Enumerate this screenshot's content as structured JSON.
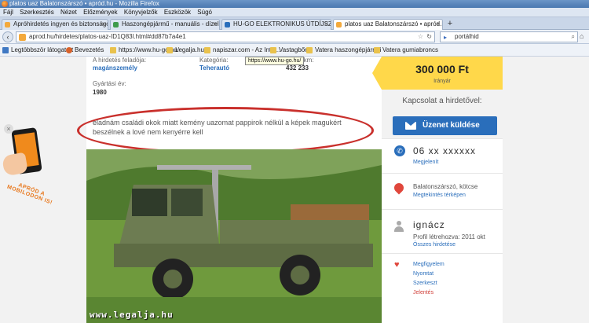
{
  "window": {
    "title": "platos uaz Balatonszárszó • apród.hu - Mozilla Firefox"
  },
  "menu": [
    "Fájl",
    "Szerkesztés",
    "Nézet",
    "Előzmények",
    "Könyvjelzők",
    "Eszközök",
    "Súgó"
  ],
  "tabs": [
    {
      "label": "Apróhirdetés ingyen és biztonságosa...",
      "icon_color": "#f3a93c"
    },
    {
      "label": "Haszongépjármű - manuális - dízel | ...",
      "icon_color": "#3f9b4c"
    },
    {
      "label": "HU-GO ELEKTRONIKUS ÚTDÍJSZEDÉSI ...",
      "icon_color": "#2a6ebb"
    },
    {
      "label": "platos uaz Balatonszárszó • apród.hu",
      "icon_color": "#f3a93c",
      "active": true
    }
  ],
  "nav": {
    "url": "aprod.hu/hirdetes/platos-uaz-ID1Q83l.html#dd87b7a4e1",
    "search_placeholder": "portálhid"
  },
  "bookmarks": [
    {
      "label": "Legtöbbször látogatott",
      "type": "blue"
    },
    {
      "label": "Bevezetés",
      "type": "dot"
    },
    {
      "label": "https://www.hu-go.hu/",
      "type": "folder"
    },
    {
      "label": "Legalja.hu",
      "type": "folder"
    },
    {
      "label": "napiszar.com - Az Inte...",
      "type": "folder"
    },
    {
      "label": "Vastagbőr",
      "type": "folder"
    },
    {
      "label": "Vatera haszongépjármű",
      "type": "folder"
    },
    {
      "label": "Vatera gumiabroncs",
      "type": "folder"
    }
  ],
  "tooltip": "https://www.hu-go.hu/",
  "listing": {
    "advertiser_label": "A hirdetés feladója:",
    "advertiser_value": "magánszemély",
    "condition_label": "Kategória:",
    "condition_value": "Teherautó",
    "mileage_label": "Futott km:",
    "mileage_value": "432 233",
    "year_label": "Gyártási év:",
    "year_value": "1980",
    "description": "eladnám családi okok miatt kemény uazomat pappirok nélkül a képek magukért beszélnek a lové nem kenyérre kell"
  },
  "watermark": "www.legalja.hu",
  "promo": {
    "text": "APRÓD A MOBILODON IS!"
  },
  "sidebar": {
    "price": "300 000 Ft",
    "price_sub": "Irányár",
    "contact_title": "Kapcsolat a hirdetővel:",
    "message_button": "Üzenet küldése",
    "phone": "06 xx xxxxxx",
    "phone_link": "Megjelenít",
    "location": "Balatonszárszó, kötcse",
    "map_link": "Megtekintés térképen",
    "user_name": "ignácz",
    "profile_created": "Profil létrehozva: 2011 okt",
    "all_ads_link": "Összes hirdetése",
    "actions": {
      "follow": "Megfigyelem",
      "print": "Nyomtat",
      "edit": "Szerkeszt",
      "report": "Jelentés"
    }
  },
  "colors": {
    "brand_blue": "#2a6ebb",
    "price_yellow": "#ffd84a",
    "highlight_red": "#c9302c"
  }
}
